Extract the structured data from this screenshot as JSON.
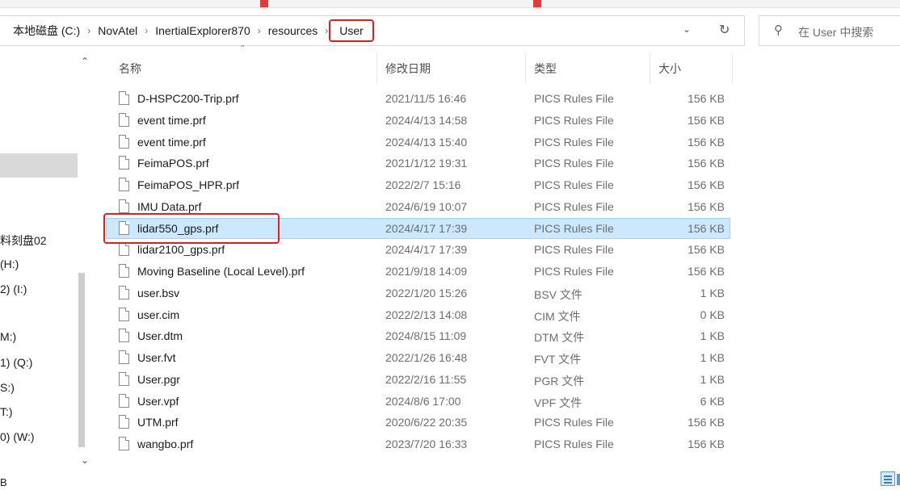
{
  "address_bar": {
    "crumbs": [
      "本地磁盘 (C:)",
      "NovAtel",
      "InertialExplorer870",
      "resources"
    ],
    "current": "User",
    "separator": "›"
  },
  "search": {
    "placeholder": "在 User 中搜索"
  },
  "nav_pane": {
    "items": [
      "料刻盘02",
      "(H:)",
      "2) (I:)",
      "M:)",
      "1) (Q:)",
      "S:)",
      "T:)",
      "0) (W:)"
    ]
  },
  "columns": {
    "name": "名称",
    "date": "修改日期",
    "type": "类型",
    "size": "大小"
  },
  "files": [
    {
      "name": "D-HSPC200-Trip.prf",
      "date": "2021/11/5 16:46",
      "type": "PICS Rules File",
      "size": "156 KB"
    },
    {
      "name": "event  time.prf",
      "date": "2024/4/13 14:58",
      "type": "PICS Rules File",
      "size": "156 KB"
    },
    {
      "name": "event time.prf",
      "date": "2024/4/13 15:40",
      "type": "PICS Rules File",
      "size": "156 KB"
    },
    {
      "name": "FeimaPOS.prf",
      "date": "2021/1/12 19:31",
      "type": "PICS Rules File",
      "size": "156 KB"
    },
    {
      "name": "FeimaPOS_HPR.prf",
      "date": "2022/2/7 15:16",
      "type": "PICS Rules File",
      "size": "156 KB"
    },
    {
      "name": "IMU Data.prf",
      "date": "2024/6/19 10:07",
      "type": "PICS Rules File",
      "size": "156 KB"
    },
    {
      "name": "lidar550_gps.prf",
      "date": "2024/4/17 17:39",
      "type": "PICS Rules File",
      "size": "156 KB"
    },
    {
      "name": "lidar2100_gps.prf",
      "date": "2024/4/17 17:39",
      "type": "PICS Rules File",
      "size": "156 KB"
    },
    {
      "name": "Moving Baseline (Local Level).prf",
      "date": "2021/9/18 14:09",
      "type": "PICS Rules File",
      "size": "156 KB"
    },
    {
      "name": "user.bsv",
      "date": "2022/1/20 15:26",
      "type": "BSV 文件",
      "size": "1 KB"
    },
    {
      "name": "user.cim",
      "date": "2022/2/13 14:08",
      "type": "CIM 文件",
      "size": "0 KB"
    },
    {
      "name": "User.dtm",
      "date": "2024/8/15 11:09",
      "type": "DTM 文件",
      "size": "1 KB"
    },
    {
      "name": "User.fvt",
      "date": "2022/1/26 16:48",
      "type": "FVT 文件",
      "size": "1 KB"
    },
    {
      "name": "User.pgr",
      "date": "2022/2/16 11:55",
      "type": "PGR 文件",
      "size": "1 KB"
    },
    {
      "name": "User.vpf",
      "date": "2024/8/6 17:00",
      "type": "VPF 文件",
      "size": "6 KB"
    },
    {
      "name": "UTM.prf",
      "date": "2020/6/22 20:35",
      "type": "PICS Rules File",
      "size": "156 KB"
    },
    {
      "name": "wangbo.prf",
      "date": "2023/7/20 16:33",
      "type": "PICS Rules File",
      "size": "156 KB"
    }
  ],
  "selected_index": 6,
  "status": {
    "left_text": "B"
  },
  "colors": {
    "accent_red": "#e11d1d",
    "selection": "#cce8ff"
  }
}
